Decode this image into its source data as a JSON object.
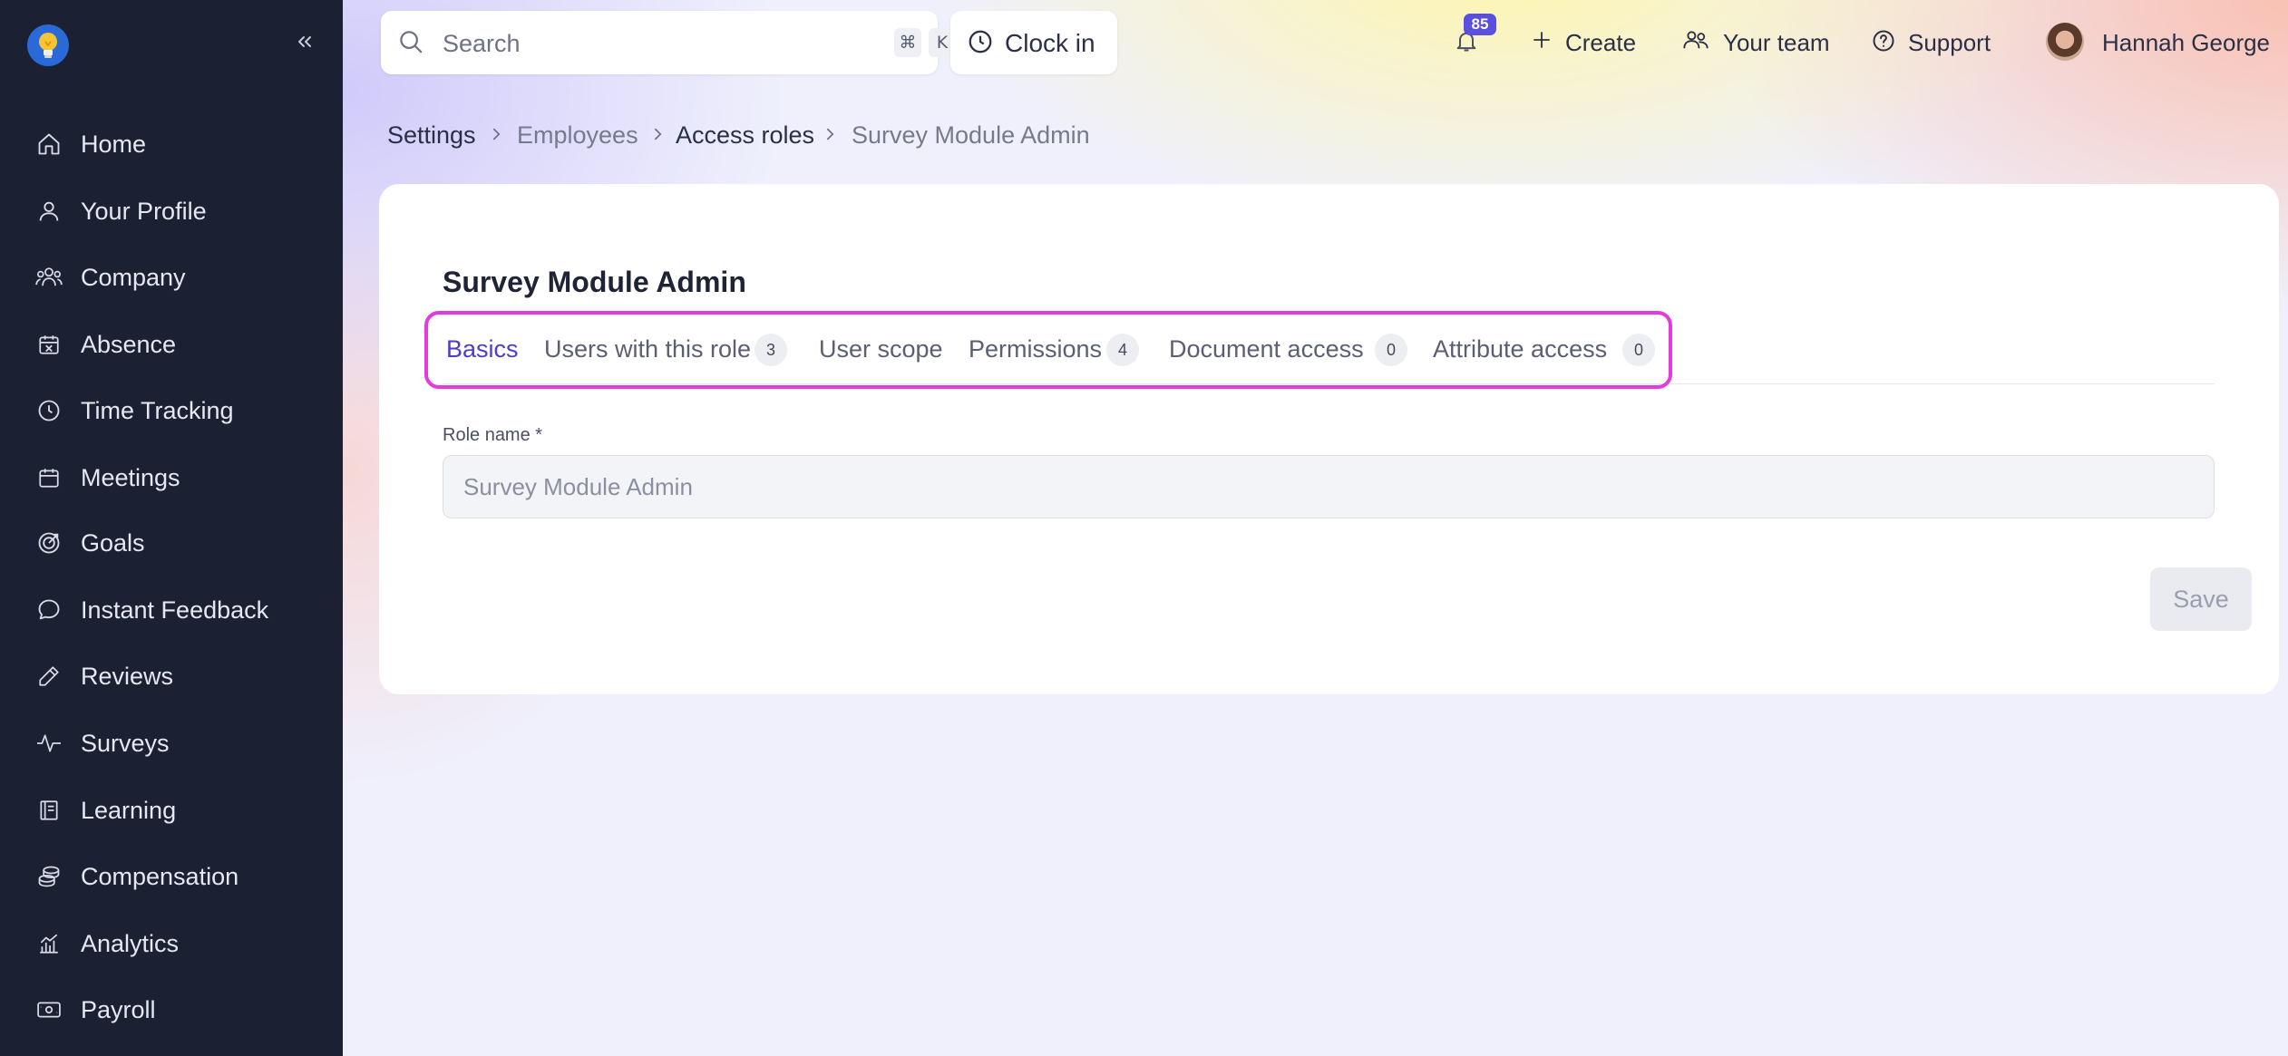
{
  "sidebar": {
    "logo_icon": "lightbulb-icon",
    "collapse_icon": "chevrons-left-icon",
    "items": [
      {
        "label": "Home",
        "icon": "home-icon"
      },
      {
        "label": "Your Profile",
        "icon": "user-icon"
      },
      {
        "label": "Company",
        "icon": "users-icon"
      },
      {
        "label": "Absence",
        "icon": "calendar-x-icon"
      },
      {
        "label": "Time Tracking",
        "icon": "clock-icon"
      },
      {
        "label": "Meetings",
        "icon": "calendar-icon"
      },
      {
        "label": "Goals",
        "icon": "target-icon"
      },
      {
        "label": "Instant Feedback",
        "icon": "chat-icon"
      },
      {
        "label": "Reviews",
        "icon": "pencil-icon"
      },
      {
        "label": "Surveys",
        "icon": "activity-icon"
      },
      {
        "label": "Learning",
        "icon": "book-icon"
      },
      {
        "label": "Compensation",
        "icon": "coins-icon"
      },
      {
        "label": "Analytics",
        "icon": "chart-icon"
      },
      {
        "label": "Payroll",
        "icon": "money-icon"
      }
    ]
  },
  "topbar": {
    "search": {
      "placeholder": "Search",
      "shortcut_keys": [
        "⌘",
        "K"
      ]
    },
    "clock_in": "Clock in",
    "notifications_count": "85",
    "create": "Create",
    "your_team": "Your team",
    "support": "Support",
    "user_name": "Hannah George"
  },
  "breadcrumb": [
    "Settings",
    "Employees",
    "Access roles",
    "Survey Module Admin"
  ],
  "card": {
    "title": "Survey Module Admin",
    "tabs": [
      {
        "label": "Basics",
        "active": true
      },
      {
        "label": "Users with this role",
        "count": "3"
      },
      {
        "label": "User scope"
      },
      {
        "label": "Permissions",
        "count": "4"
      },
      {
        "label": "Document access",
        "count": "0"
      },
      {
        "label": "Attribute access",
        "count": "0"
      }
    ],
    "role_name_label": "Role name *",
    "role_name_value": "Survey Module Admin",
    "save_label": "Save"
  },
  "colors": {
    "sidebar_bg": "#1c2033",
    "accent": "#4a3fc9",
    "badge": "#5b4fe0",
    "highlight": "#e43bdc"
  }
}
